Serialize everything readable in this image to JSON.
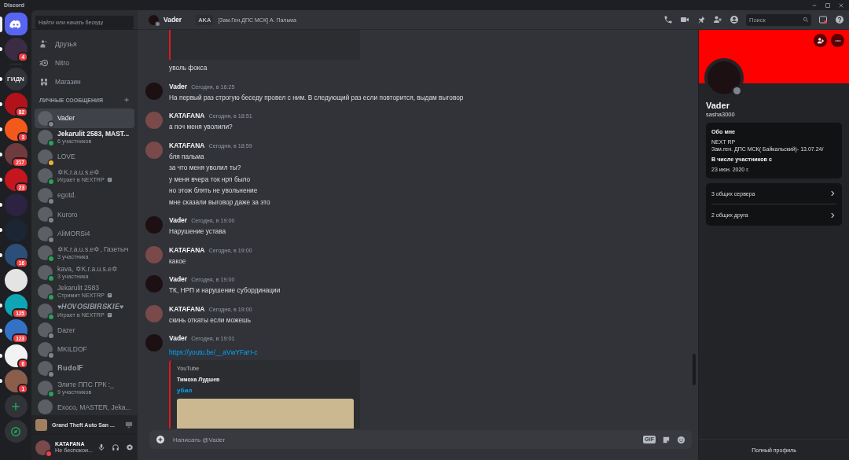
{
  "app_title": "Discord",
  "servers": [
    {
      "kind": "home",
      "selected": true
    },
    {
      "kind": "avatar",
      "selected": false,
      "unread": true,
      "badge": "4",
      "color": "#3b2c44"
    },
    {
      "kind": "separator"
    },
    {
      "kind": "text",
      "label": "ГИДN",
      "selected": false,
      "unread": true
    },
    {
      "kind": "avatar",
      "selected": false,
      "unread": true,
      "badge": "82",
      "color": "#b3121b"
    },
    {
      "kind": "avatar",
      "selected": false,
      "unread": true,
      "badge": "3",
      "color": "#f2591a"
    },
    {
      "kind": "avatar",
      "selected": false,
      "unread": true,
      "badge": "217",
      "color": "#6e3b3e"
    },
    {
      "kind": "avatar",
      "selected": false,
      "unread": true,
      "badge": "23",
      "color": "#c3161f"
    },
    {
      "kind": "avatar",
      "selected": false,
      "unread": true,
      "color": "#2c2242"
    },
    {
      "kind": "avatar",
      "selected": false,
      "unread": true,
      "color": "#1c2533"
    },
    {
      "kind": "avatar",
      "selected": false,
      "unread": true,
      "badge": "16",
      "color": "#2b4f78"
    },
    {
      "kind": "avatar",
      "selected": false,
      "unread": false,
      "color": "#e4e4e4"
    },
    {
      "kind": "avatar",
      "selected": false,
      "unread": true,
      "badge": "125",
      "color": "#0ea5b5"
    },
    {
      "kind": "avatar",
      "selected": false,
      "unread": true,
      "badge": "123",
      "color": "#3372c4"
    },
    {
      "kind": "avatar",
      "selected": false,
      "unread": true,
      "badge": "6",
      "color": "#f2f2f2"
    },
    {
      "kind": "avatar",
      "selected": false,
      "unread": true,
      "badge": "1",
      "color": "#8b5d4b"
    },
    {
      "kind": "add",
      "selected": false,
      "unread": false
    },
    {
      "kind": "explore",
      "selected": false,
      "unread": false
    }
  ],
  "dm_search": {
    "placeholder": "Найти или начать беседу"
  },
  "dm_nav": [
    {
      "kind": "friends",
      "label": "Друзья"
    },
    {
      "kind": "nitro",
      "label": "Nitro"
    },
    {
      "kind": "shop",
      "label": "Магазин"
    }
  ],
  "dm_header": "ЛИЧНЫЕ СООБЩЕНИЯ",
  "dms": [
    {
      "name": "Vader",
      "color": "#80848e",
      "selected": true,
      "unread": false
    },
    {
      "name": "Jekarulit 2583, MAST...",
      "subtitle": "6 участников",
      "color": "#23a559",
      "selected": false,
      "unread": true
    },
    {
      "name": "LOVE",
      "color": "#f0b232",
      "selected": false,
      "unread": false
    },
    {
      "name": "✡K.r.a.u.s.e✡",
      "subtitle": "Играет в NEXTRP",
      "rich_presence": true,
      "color": "#23a559",
      "selected": false,
      "unread": false
    },
    {
      "name": "egotd.",
      "color": "#80848e",
      "selected": false,
      "unread": false
    },
    {
      "name": "Kuroro",
      "color": "#80848e",
      "selected": false,
      "unread": false
    },
    {
      "name": "AliMORSi4",
      "color": "#80848e",
      "selected": false,
      "unread": false
    },
    {
      "name": "✡K.r.a.u.s.e✡, Газетыч",
      "subtitle": "3 участника",
      "color": "#23a559",
      "selected": false,
      "unread": false
    },
    {
      "name": "kava, ✡K.r.a.u.s.e✡",
      "subtitle": "3 участника",
      "color": "#23a559",
      "selected": false,
      "unread": false
    },
    {
      "name": "Jekarulit 2583",
      "subtitle": "Стримит NEXTRP",
      "rich_presence": true,
      "color": "#23a559",
      "selected": false,
      "unread": false
    },
    {
      "name": "♥𝑯𝑶𝑽𝑶𝑺𝑰𝑩𝑰𝑹𝑺𝑲𝑰𝑬♥",
      "subtitle": "Играет в NEXTRP",
      "rich_presence": true,
      "color": "#23a559",
      "selected": false,
      "unread": false
    },
    {
      "name": "Dazer",
      "color": "#80848e",
      "selected": false,
      "unread": false
    },
    {
      "name": "MKILDOF",
      "color": "#80848e",
      "selected": false,
      "unread": false
    },
    {
      "name": "𝐑𝐮𝐝𝐨𝐥𝐅",
      "color": "#80848e",
      "selected": false,
      "unread": false
    },
    {
      "name": "Элите ППС ГРК :_",
      "subtitle": "9 участников",
      "color": "#23a559",
      "selected": false,
      "unread": false
    },
    {
      "name": "Exoco, MASTER, Jeka...",
      "selected": false,
      "unread": false
    }
  ],
  "activity": {
    "title": "Grand Theft Auto San ..."
  },
  "user_panel": {
    "name": "KATAFANA",
    "status_text": "Не беспокои...",
    "color": "#f23f43"
  },
  "chat_header": {
    "name": "Vader",
    "color": "#80848e",
    "aka_badge": "AKA",
    "aka_name": "[Зам.Ген.ДПС МСК] А. Пальма",
    "search": {
      "placeholder": "Поиск"
    }
  },
  "messages": [
    {
      "kind": "continuation",
      "embed_tail": true,
      "lines": [
        "уволь фокса"
      ]
    },
    {
      "kind": "group",
      "author": "Vader",
      "color": "#1c1012",
      "time": "Сегодня, в 16:25",
      "lines": [
        "На первый раз строгую беседу провел с ним. В следующий раз если повторится, выдам выговор"
      ]
    },
    {
      "kind": "group",
      "author": "KATAFANA",
      "color": "#7a4a4a",
      "time": "Сегодня, в 18:51",
      "lines": [
        "а поч меня уволили?"
      ]
    },
    {
      "kind": "group",
      "author": "KATAFANA",
      "color": "#7a4a4a",
      "time": "Сегодня, в 18:59",
      "lines": [
        "бля пальма",
        "за что меня уволил ты?",
        "у меня вчера ток нрп было",
        "но этож блять не увольнение",
        "мне сказали выговор даже за это"
      ]
    },
    {
      "kind": "group",
      "author": "Vader",
      "color": "#1c1012",
      "time": "Сегодня, в 19:00",
      "lines": [
        "Нарушение устава"
      ]
    },
    {
      "kind": "group",
      "author": "KATAFANA",
      "color": "#7a4a4a",
      "time": "Сегодня, в 19:00",
      "lines": [
        "какое"
      ]
    },
    {
      "kind": "group",
      "author": "Vader",
      "color": "#1c1012",
      "time": "Сегодня, в 19:00",
      "lines": [
        "ТК, НРП и нарушение субординации"
      ]
    },
    {
      "kind": "group",
      "author": "KATAFANA",
      "color": "#7a4a4a",
      "time": "Сегодня, в 19:00",
      "lines": [
        "скинь откаты если можешь"
      ]
    },
    {
      "kind": "group",
      "author": "Vader",
      "color": "#1c1012",
      "time": "Сегодня, в 19:01",
      "link": "https://youtu.be/__aVwYFaH-c",
      "embed": {
        "provider": "YouTube",
        "author": "Тимоха Лудшев",
        "title": "убил"
      }
    }
  ],
  "composer": {
    "placeholder": "Написать @Vader",
    "gif": "GIF"
  },
  "profile": {
    "name": "Vader",
    "username": "sasha3000",
    "color": "#80848e",
    "about_heading": "Обо мне",
    "about_lines": [
      "NEXT RP",
      "Зам.ген. ДПС МСК( Байкальский)- 13.07.24/"
    ],
    "member_heading": "В числе участников с",
    "member_since": "23 июн. 2020 г.",
    "mutual": [
      "3 общих сервера",
      "2 общих друга"
    ],
    "footer": "Полный профиль"
  }
}
